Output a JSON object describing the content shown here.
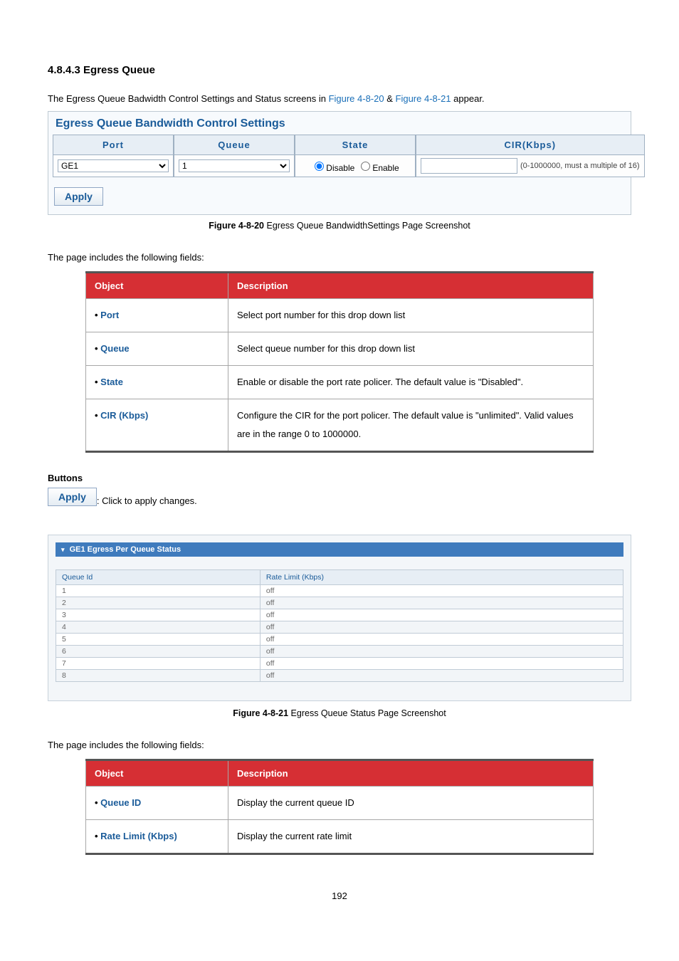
{
  "section_title": "4.8.4.3 Egress Queue",
  "intro_prefix": "The Egress Queue Badwidth Control Settings and Status screens in ",
  "intro_link1": "Figure 4-8-20",
  "intro_amp": " & ",
  "intro_link2": "Figure 4-8-21",
  "intro_suffix": " appear.",
  "settings": {
    "panel_title": "Egress Queue Bandwidth Control Settings",
    "headers": {
      "port": "Port",
      "queue": "Queue",
      "state": "State",
      "cir": "CIR(Kbps)"
    },
    "port_value": "GE1",
    "queue_value": "1",
    "state_disable": "Disable",
    "state_enable": "Enable",
    "cir_value": "",
    "cir_hint": "(0-1000000, must a multiple of 16)",
    "apply_label": "Apply"
  },
  "caption1_bold": "Figure 4-8-20",
  "caption1_rest": " Egress Queue BandwidthSettings Page Screenshot",
  "fields_intro": "The page includes the following fields:",
  "desc1": {
    "h_object": "Object",
    "h_description": "Description",
    "rows": [
      {
        "obj": "Port",
        "desc": "Select port number for this drop down list"
      },
      {
        "obj": "Queue",
        "desc": "Select queue number for this drop down list"
      },
      {
        "obj": "State",
        "desc": "Enable or disable the port rate policer. The default value is \"Disabled\"."
      },
      {
        "obj": "CIR (Kbps)",
        "desc": "Configure the CIR for the port policer. The default value is \"unlimited\". Valid values are in the range 0 to 1000000."
      }
    ]
  },
  "buttons_heading": "Buttons",
  "buttons_apply_desc": ": Click to apply changes.",
  "status": {
    "header": "GE1 Egress Per Queue Status",
    "h_queue": "Queue Id",
    "h_rate": "Rate Limit (Kbps)",
    "rows": [
      {
        "id": "1",
        "rate": "off"
      },
      {
        "id": "2",
        "rate": "off"
      },
      {
        "id": "3",
        "rate": "off"
      },
      {
        "id": "4",
        "rate": "off"
      },
      {
        "id": "5",
        "rate": "off"
      },
      {
        "id": "6",
        "rate": "off"
      },
      {
        "id": "7",
        "rate": "off"
      },
      {
        "id": "8",
        "rate": "off"
      }
    ]
  },
  "chart_data": {
    "type": "table",
    "title": "GE1 Egress Per Queue Status",
    "columns": [
      "Queue Id",
      "Rate Limit (Kbps)"
    ],
    "rows": [
      [
        "1",
        "off"
      ],
      [
        "2",
        "off"
      ],
      [
        "3",
        "off"
      ],
      [
        "4",
        "off"
      ],
      [
        "5",
        "off"
      ],
      [
        "6",
        "off"
      ],
      [
        "7",
        "off"
      ],
      [
        "8",
        "off"
      ]
    ]
  },
  "caption2_bold": "Figure 4-8-21",
  "caption2_rest": " Egress Queue Status Page Screenshot",
  "desc2": {
    "h_object": "Object",
    "h_description": "Description",
    "rows": [
      {
        "obj": "Queue ID",
        "desc": "Display the current queue ID"
      },
      {
        "obj": "Rate Limit (Kbps)",
        "desc": "Display the current rate limit"
      }
    ]
  },
  "page_number": "192"
}
